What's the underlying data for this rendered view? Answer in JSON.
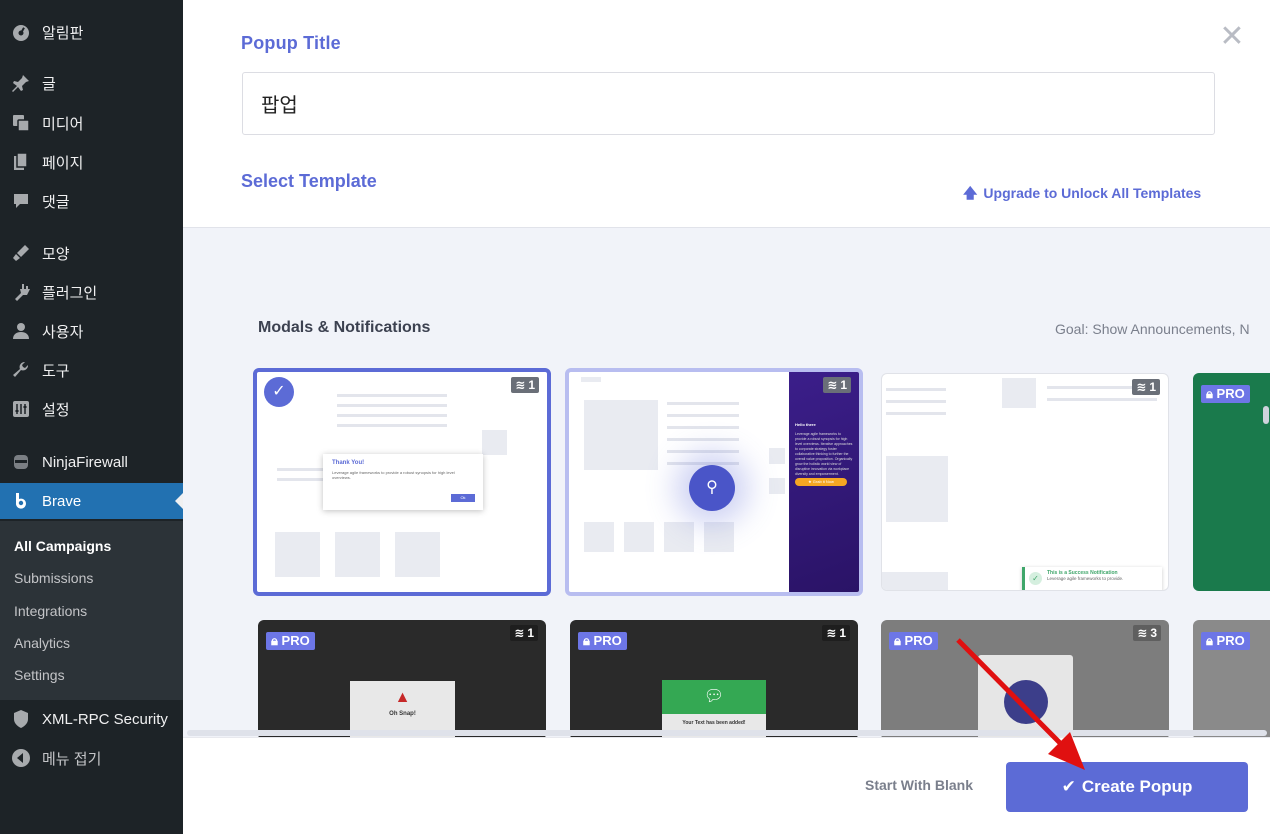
{
  "sidebar": {
    "items": [
      {
        "label": "알림판",
        "icon": "dashboard-icon"
      },
      {
        "label": "글",
        "icon": "pin-icon"
      },
      {
        "label": "미디어",
        "icon": "media-icon"
      },
      {
        "label": "페이지",
        "icon": "page-icon"
      },
      {
        "label": "댓글",
        "icon": "comment-icon"
      },
      {
        "label": "모양",
        "icon": "appearance-icon"
      },
      {
        "label": "플러그인",
        "icon": "plugin-icon"
      },
      {
        "label": "사용자",
        "icon": "user-icon"
      },
      {
        "label": "도구",
        "icon": "wrench-icon"
      },
      {
        "label": "설정",
        "icon": "settings-icon"
      },
      {
        "label": "NinjaFirewall",
        "icon": "ninja-icon"
      },
      {
        "label": "Brave",
        "icon": "brave-icon"
      },
      {
        "label": "XML-RPC Security",
        "icon": "shield-icon"
      },
      {
        "label": "메뉴 접기",
        "icon": "collapse-icon"
      }
    ],
    "submenu": [
      "All Campaigns",
      "Submissions",
      "Integrations",
      "Analytics",
      "Settings"
    ]
  },
  "form": {
    "title_label": "Popup Title",
    "title_value": "팝업",
    "template_label": "Select Template",
    "upgrade_link": "Upgrade to Unlock All Templates",
    "close_glyph": "✕"
  },
  "gallery": {
    "section_title": "Modals & Notifications",
    "goal_text": "Goal: Show Announcements, N",
    "cards": [
      {
        "count": "1",
        "pro": false,
        "selected": true,
        "heading": "Thank You!",
        "body": "Leverage agile frameworks to provide a robust synopsis for high level overviews.",
        "button": "Ok"
      },
      {
        "count": "1",
        "pro": false,
        "selected": false,
        "heading": "Hello there",
        "body": "Leverage agile frameworks to provide a robust synopsis for high level overviews. Iterative approaches to corporate strategy foster collaborative thinking to further the overall value proposition. Organically grow the holistic world view of disruptive innovation via workplace diversity and empowerment.",
        "button": "★ Grab it Now"
      },
      {
        "count": "1",
        "pro": false,
        "selected": false,
        "heading": "This is a Success Notification",
        "body": "Leverage agile frameworks to provide."
      },
      {
        "count": "",
        "pro": true,
        "pro_label": "PRO"
      },
      {
        "count": "1",
        "pro": true,
        "pro_label": "PRO",
        "heading": "Oh Snap!"
      },
      {
        "count": "1",
        "pro": true,
        "pro_label": "PRO",
        "heading": "Your Text has been added!"
      },
      {
        "count": "3",
        "pro": true,
        "pro_label": "PRO"
      },
      {
        "count": "",
        "pro": true,
        "pro_label": "PRO"
      }
    ]
  },
  "footer": {
    "blank_label": "Start With Blank",
    "create_label": "Create Popup"
  },
  "colors": {
    "accent": "#5c6bd6",
    "sidebar_bg": "#1d2327",
    "active_bg": "#2271b1",
    "annotation_arrow": "#e01010"
  }
}
